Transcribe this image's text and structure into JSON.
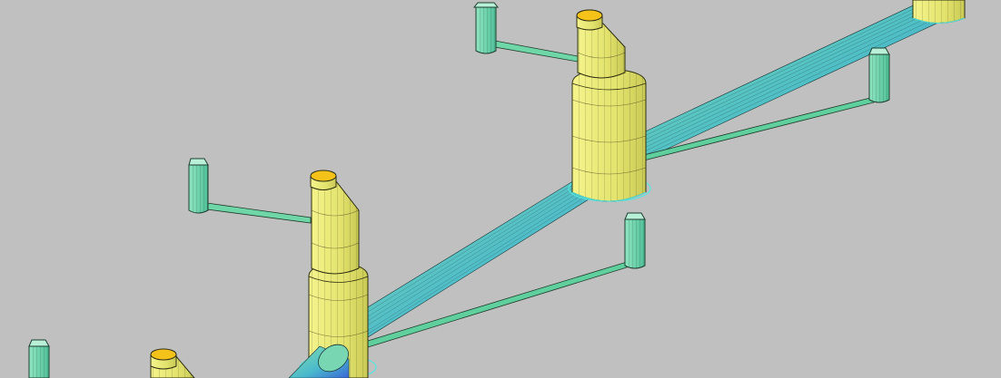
{
  "viewport": {
    "background": "#c0c0c0",
    "visual_style": "Realistic 3D shaded",
    "colors": {
      "manhole_fill": "#ecec7a",
      "manhole_dark": "#cfcf58",
      "manhole_line": "#2e2e10",
      "manhole_top": "#f5c21a",
      "pipe_light": "#7fe0b4",
      "pipe_dark": "#3d6fd8",
      "pipe_line": "#1a3a3a",
      "inlet_fill": "#6fd6a8",
      "inlet_top": "#b8f0d8",
      "base_ring": "#55e6e0"
    }
  },
  "objects": [
    {
      "name": "manhole-1",
      "kind": "manhole"
    },
    {
      "name": "manhole-2",
      "kind": "manhole"
    },
    {
      "name": "manhole-3",
      "kind": "manhole"
    },
    {
      "name": "manhole-4",
      "kind": "manhole"
    },
    {
      "name": "main-pipe",
      "kind": "pipe"
    },
    {
      "name": "inlet-1",
      "kind": "inlet"
    },
    {
      "name": "inlet-2",
      "kind": "inlet"
    },
    {
      "name": "inlet-3",
      "kind": "inlet"
    },
    {
      "name": "inlet-4",
      "kind": "inlet"
    },
    {
      "name": "inlet-5",
      "kind": "inlet"
    }
  ]
}
